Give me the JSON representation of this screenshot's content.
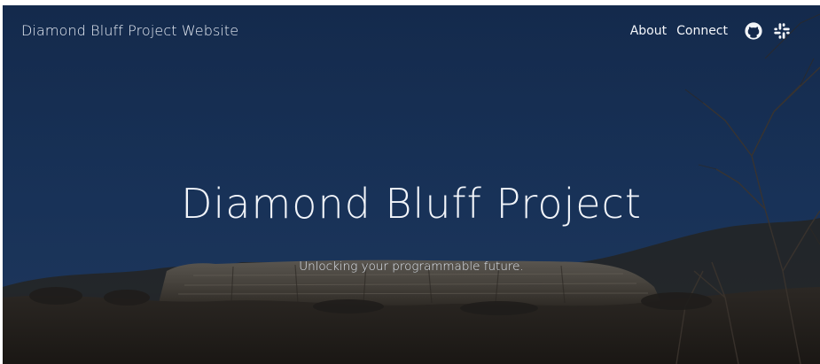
{
  "header": {
    "site_title": "Diamond Bluff Project Website",
    "nav": [
      {
        "label": "About"
      },
      {
        "label": "Connect"
      }
    ],
    "icons": [
      "github-icon",
      "slack-icon"
    ]
  },
  "hero": {
    "title": "Diamond Bluff Project",
    "tagline": "Unlocking your programmable future."
  },
  "colors": {
    "sky_dark": "#0f2140",
    "sky_mid": "#1e3658",
    "text": "#f2f5fa"
  }
}
